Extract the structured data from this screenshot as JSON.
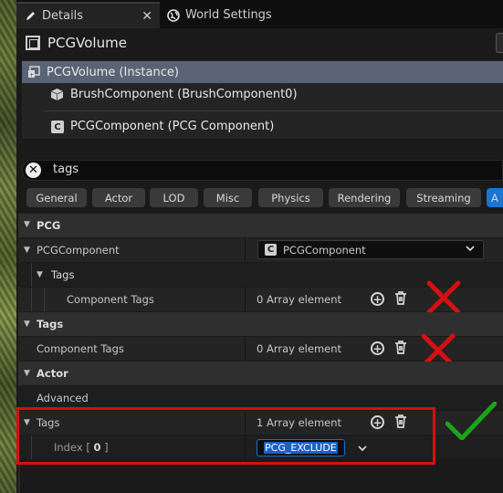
{
  "tabs": [
    {
      "label": "Details",
      "icon": "pencil-icon",
      "active": true
    },
    {
      "label": "World Settings",
      "icon": "globe-icon",
      "active": false
    }
  ],
  "actor": {
    "name": "PCGVolume"
  },
  "components": [
    {
      "label": "PCGVolume (Instance)",
      "icon": "instance-icon",
      "selected": true
    },
    {
      "label": "BrushComponent (BrushComponent0)",
      "icon": "cube-icon"
    },
    {
      "label": "PCGComponent (PCG Component)",
      "icon": "cpp-class-icon"
    }
  ],
  "search": {
    "value": "tags"
  },
  "filters": [
    "General",
    "Actor",
    "LOD",
    "Misc",
    "Physics",
    "Rendering",
    "Streaming",
    "A"
  ],
  "properties": {
    "pcg_category": "PCG",
    "pcg_component_label": "PCGComponent",
    "pcg_component_value": "PCGComponent",
    "tags_subcategory": "Tags",
    "component_tags_label": "Component Tags",
    "component_tags_value": "0 Array element",
    "tags_category": "Tags",
    "component_tags2_label": "Component Tags",
    "component_tags2_value": "0 Array element",
    "actor_category": "Actor",
    "advanced_label": "Advanced",
    "actor_tags_label": "Tags",
    "actor_tags_value": "1 Array element",
    "index_label_prefix": "Index [ ",
    "index_number": "0",
    "index_label_suffix": " ]",
    "index_value": "PCG_EXCLUDE"
  },
  "colors": {
    "selection": "#5a6375",
    "accent": "#1a74d2",
    "annotation_red": "#d41010",
    "annotation_green": "#1aa51a"
  }
}
